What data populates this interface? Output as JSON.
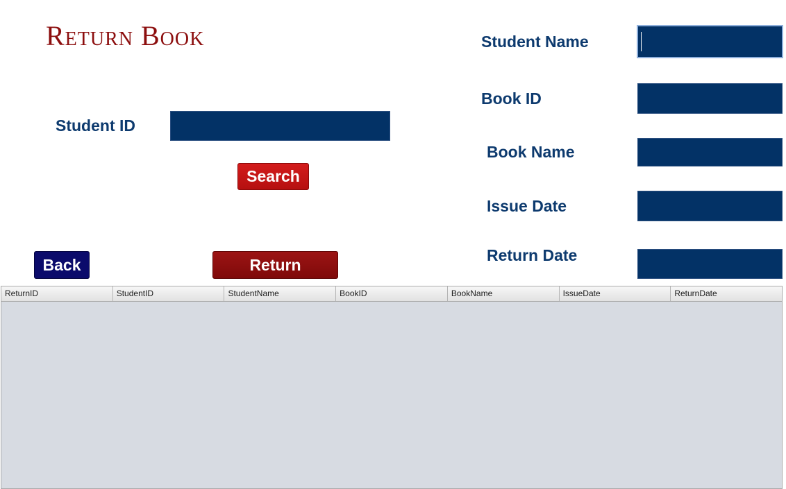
{
  "title": "Return Book",
  "left": {
    "student_id_label": "Student ID",
    "student_id_value": "",
    "search_button": "Search",
    "back_button": "Back",
    "return_button": "Return"
  },
  "right": {
    "student_name_label": "Student Name",
    "student_name_value": "",
    "book_id_label": "Book ID",
    "book_id_value": "",
    "book_name_label": "Book Name",
    "book_name_value": "",
    "issue_date_label": "Issue Date",
    "issue_date_value": "",
    "return_date_label": "Return Date",
    "return_date_value": ""
  },
  "table": {
    "columns": [
      "ReturnID",
      "StudentID",
      "StudentName",
      "BookID",
      "BookName",
      "IssueDate",
      "ReturnDate"
    ],
    "rows": []
  },
  "colors": {
    "title": "#8c0e0e",
    "label": "#0d3a6e",
    "field": "#033266",
    "search_button": "#c41616",
    "back_button": "#0b0b6b",
    "return_button": "#8f0f0f",
    "table_body": "#d7dbe2"
  }
}
